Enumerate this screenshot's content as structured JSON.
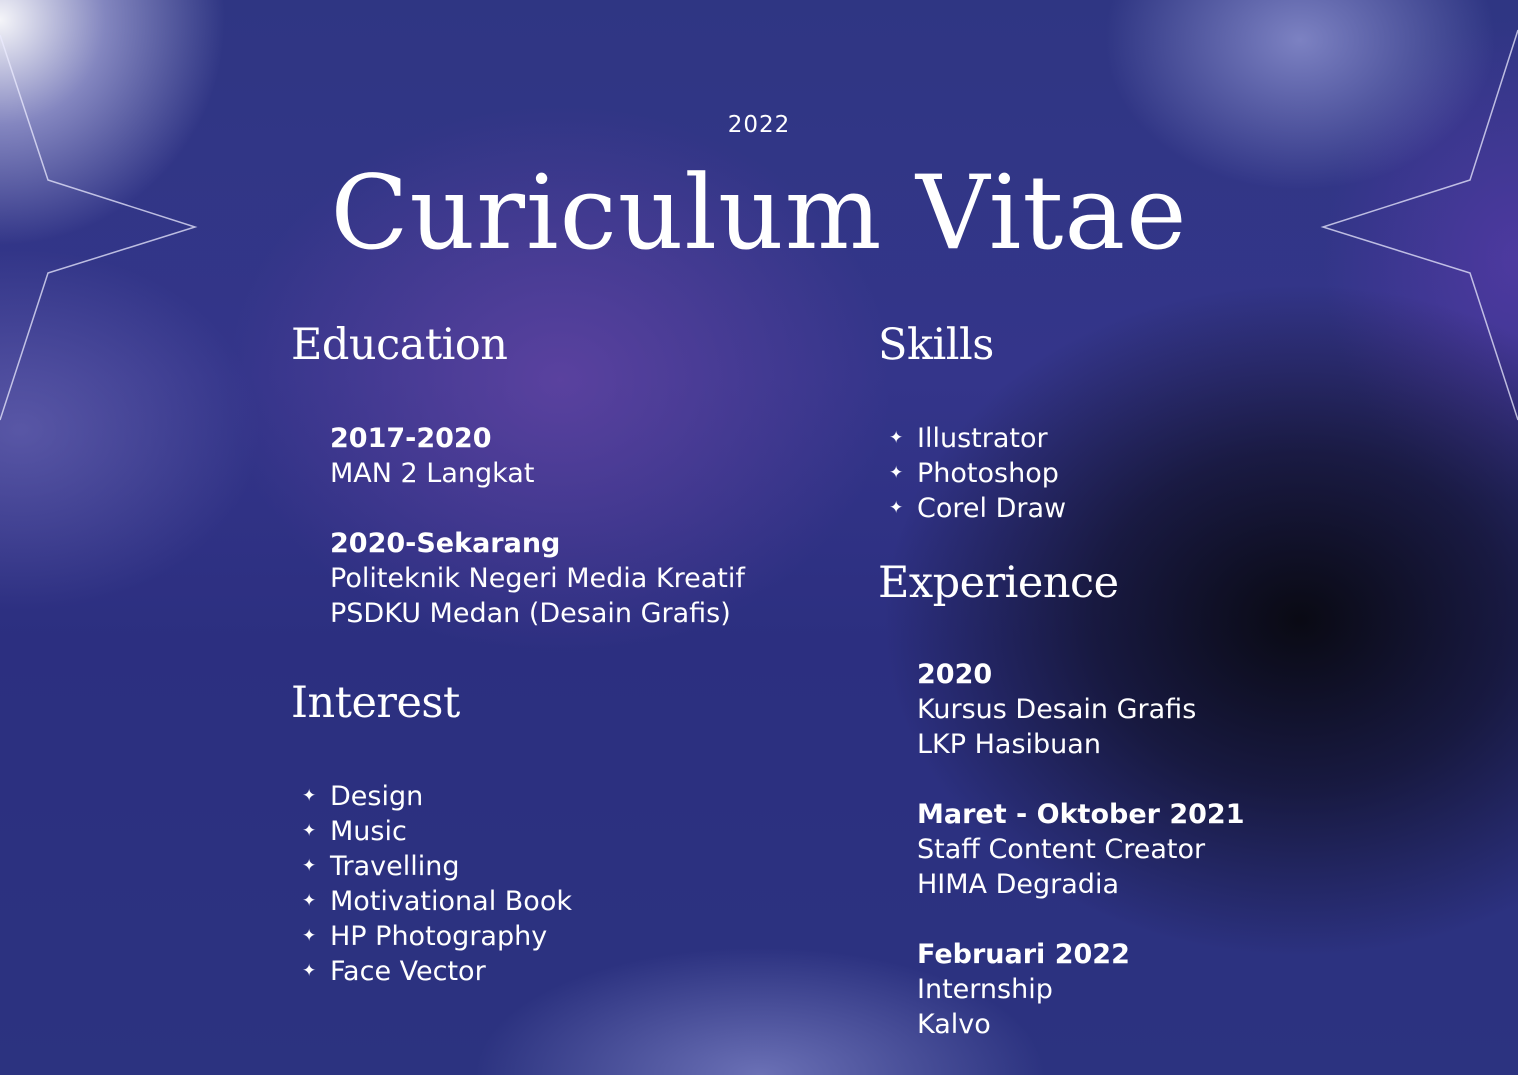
{
  "header": {
    "year": "2022",
    "title": "Curiculum Vitae"
  },
  "education": {
    "heading": "Education",
    "entries": [
      {
        "period": "2017-2020",
        "lines": [
          "MAN 2 Langkat"
        ]
      },
      {
        "period": "2020-Sekarang",
        "lines": [
          "Politeknik Negeri Media Kreatif",
          "PSDKU Medan (Desain Grafis)"
        ]
      }
    ]
  },
  "interest": {
    "heading": "Interest",
    "items": [
      "Design",
      "Music",
      "Travelling",
      "Motivational Book",
      "HP Photography",
      "Face Vector"
    ]
  },
  "skills": {
    "heading": "Skills",
    "items": [
      "Illustrator",
      "Photoshop",
      "Corel Draw"
    ]
  },
  "experience": {
    "heading": "Experience",
    "entries": [
      {
        "period": "2020",
        "lines": [
          "Kursus Desain Grafis",
          "LKP Hasibuan"
        ]
      },
      {
        "period": "Maret - Oktober 2021",
        "lines": [
          "Staff Content Creator",
          "HIMA Degradia"
        ]
      },
      {
        "period": "Februari 2022",
        "lines": [
          "Internship",
          "Kalvo"
        ]
      }
    ]
  },
  "icons": {
    "bullet": "four-point-sparkle-icon",
    "decoration": "star-outline-icon"
  },
  "colors": {
    "text": "#ffffff",
    "background_primary": "#2f3683",
    "background_accent": "#6e48aa",
    "background_dark": "#08080e"
  }
}
